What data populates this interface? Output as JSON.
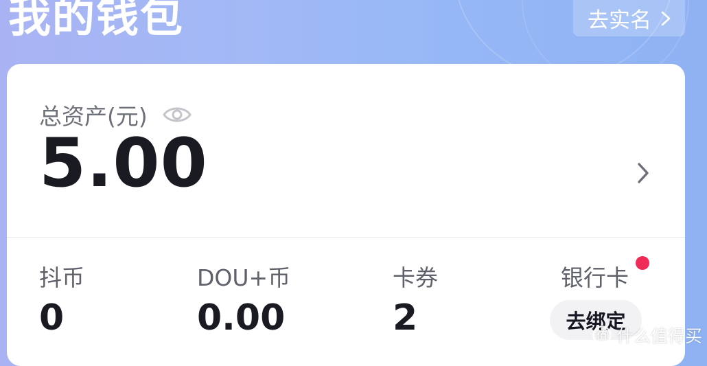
{
  "header": {
    "title": "我的钱包",
    "verify_label": "去实名"
  },
  "total": {
    "label": "总资产(元)",
    "amount": "5.00"
  },
  "assets": [
    {
      "label": "抖币",
      "value": "0"
    },
    {
      "label": "DOU+币",
      "value": "0.00"
    },
    {
      "label": "卡券",
      "value": "2"
    },
    {
      "label": "银行卡",
      "action": "去绑定"
    }
  ],
  "watermark": {
    "text": "什么值得买"
  },
  "colors": {
    "accent_red": "#f02b58",
    "header_gradient_start": "#a9b3f4",
    "header_gradient_end": "#8fb2f3"
  },
  "icons": {
    "verify": "chevron-right-icon",
    "total_visibility": "eye-icon",
    "total_detail": "chevron-right-icon",
    "watermark": "smzdm-logo-icon"
  }
}
